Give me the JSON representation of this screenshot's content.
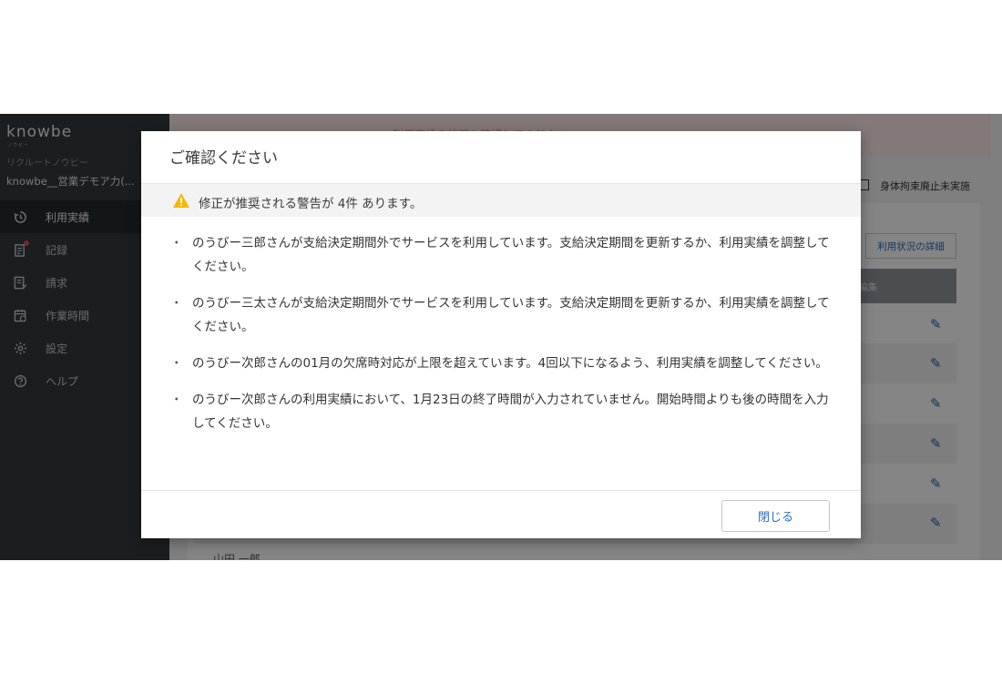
{
  "app": {
    "logo_text": "knowbe",
    "logo_sub": "ノウビー",
    "organization": "リクルートノウビー",
    "facility_name": "knowbe__営業デモア力(..."
  },
  "sidebar": {
    "items": [
      {
        "label": "利用実績",
        "icon": "history-icon",
        "active": true
      },
      {
        "label": "記録",
        "icon": "records-icon",
        "badge": true
      },
      {
        "label": "請求",
        "icon": "billing-icon"
      },
      {
        "label": "作業時間",
        "icon": "calendar-icon"
      },
      {
        "label": "設定",
        "icon": "gear-icon"
      },
      {
        "label": "ヘルプ",
        "icon": "help-icon"
      }
    ]
  },
  "background": {
    "alert_text": "利用実績の状況を確認してください",
    "checkbox_label": "身体拘束廃止未実施",
    "detail_button": "利用状況の詳細",
    "table_header": "編集",
    "bottom_name": "山田 一郎"
  },
  "dialog": {
    "title": "ご確認ください",
    "warning_summary": "修正が推奨される警告が 4件 あります。",
    "warnings": [
      "のうびー三郎さんが支給決定期間外でサービスを利用しています。支給決定期間を更新するか、利用実績を調整してください。",
      "のうびー三太さんが支給決定期間外でサービスを利用しています。支給決定期間を更新するか、利用実績を調整してください。",
      "のうびー次郎さんの01月の欠席時対応が上限を超えています。4回以下になるよう、利用実績を調整してください。",
      "のうびー次郎さんの利用実績において、1月23日の終了時間が入力されていません。開始時間よりも後の時間を入力してください。"
    ],
    "close_button": "閉じる"
  },
  "colors": {
    "sidebar_bg": "#333a3f",
    "warning_icon": "#f5b800",
    "link_blue": "#2b6fbd"
  }
}
